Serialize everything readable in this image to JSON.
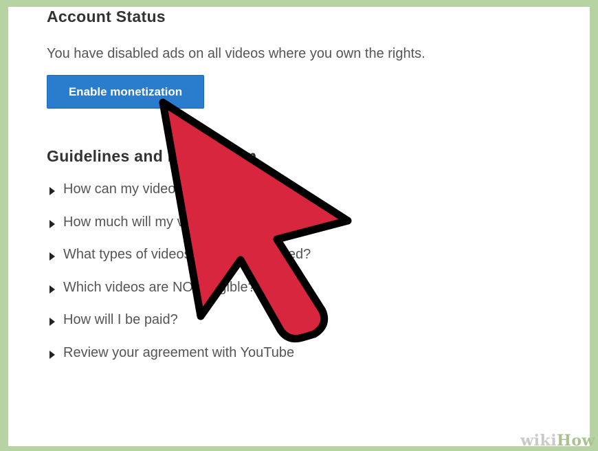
{
  "account_status": {
    "title": "Account Status",
    "message": "You have disabled ads on all videos where you own the rights.",
    "button_label": "Enable monetization"
  },
  "guidelines": {
    "title": "Guidelines and Information",
    "items": [
      {
        "label": "How can my videos be monetized?"
      },
      {
        "label": "How much will my videos earn?"
      },
      {
        "label": "What types of videos can be monetized?"
      },
      {
        "label": "Which videos are NOT eligible?"
      },
      {
        "label": "How will I be paid?"
      },
      {
        "label": "Review your agreement with YouTube"
      }
    ]
  },
  "overlay": {
    "cursor_icon": "mouse-pointer-arrow",
    "cursor_color": "#d7263d"
  },
  "watermark": {
    "wiki": "wiki",
    "how": "How"
  },
  "colors": {
    "frame_border": "#b8d3a3",
    "button_bg": "#2a7ccd"
  }
}
